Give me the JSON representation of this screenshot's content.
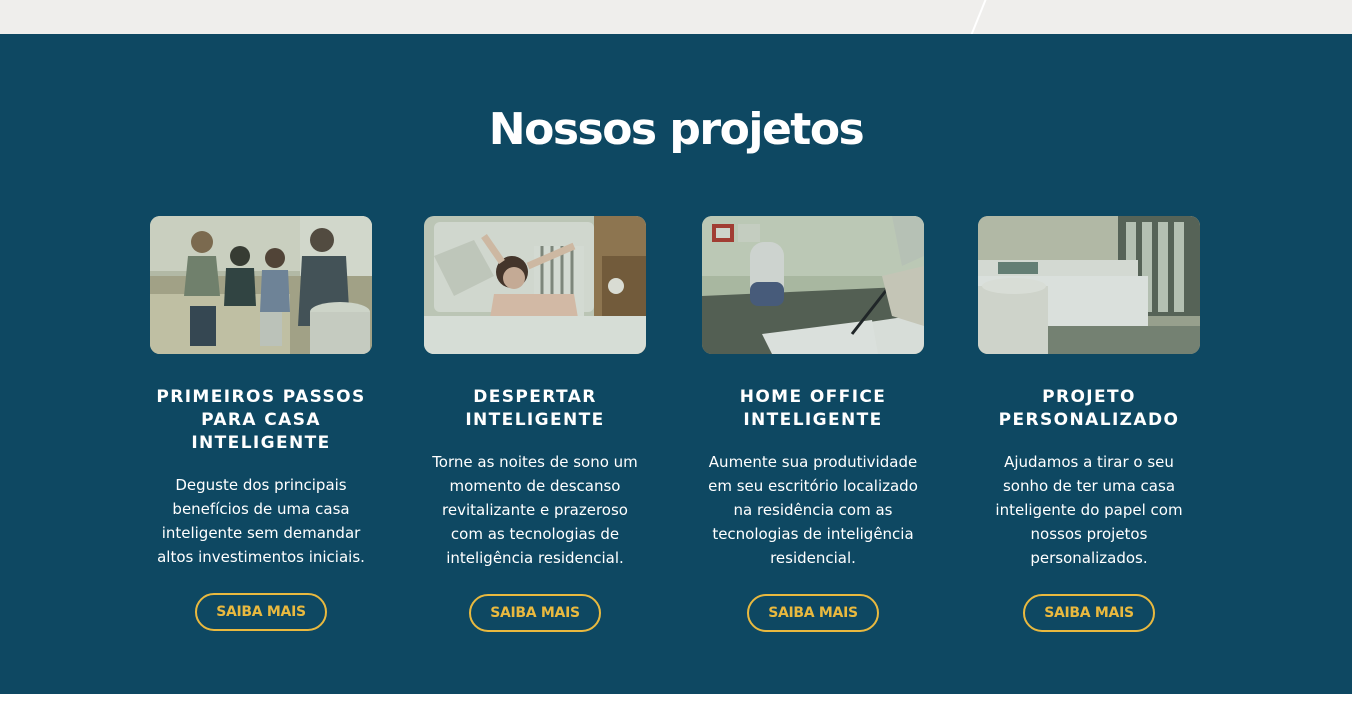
{
  "section": {
    "title": "Nossos projetos",
    "background": "#0e4862",
    "accent": "#e9b93f"
  },
  "projects": [
    {
      "title": "PRIMEIROS PASSOS\nPARA CASA INTELIGENTE",
      "text": "Deguste dos principais\nbenefícios de uma casa\ninteligente sem demandar\naltos investimentos iniciais.",
      "button": "SAIBA MAIS",
      "image": "family-watching-tv-photo"
    },
    {
      "title": "DESPERTAR\nINTELIGENTE",
      "text": "Torne as noites de sono um\nmomento de descanso\nrevitalizante e prazeroso\ncom as tecnologias de\ninteligência residencial.",
      "button": "SAIBA MAIS",
      "image": "woman-waking-up-photo"
    },
    {
      "title": "HOME OFFICE\nINTELIGENTE",
      "text": "Aumente sua produtividade\nem seu escritório localizado\nna residência com as\ntecnologias de inteligência\nresidencial.",
      "button": "SAIBA MAIS",
      "image": "smart-speaker-desk-photo"
    },
    {
      "title": "PROJETO\nPERSONALIZADO",
      "text": "Ajudamos a tirar o seu\nsonho de ter uma casa\ninteligente do papel com\nnossos projetos\npersonalizados.",
      "button": "SAIBA MAIS",
      "image": "smart-bedroom-photo"
    }
  ]
}
